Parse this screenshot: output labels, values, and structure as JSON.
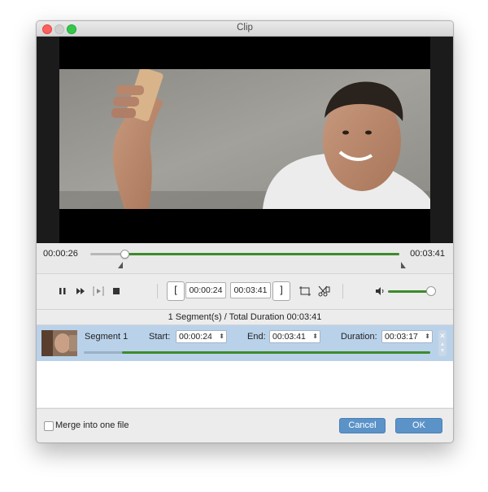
{
  "window": {
    "title": "Clip"
  },
  "timeline": {
    "current_time": "00:00:26",
    "total_time": "00:03:41",
    "playhead_fraction": 0.11
  },
  "controls": {
    "icons": [
      "pause-icon",
      "fast-forward-icon",
      "play-segment-icon",
      "stop-icon",
      "crop-icon",
      "cut-icon",
      "volume-icon"
    ],
    "set_start_label": "[",
    "set_end_label": "]",
    "start_time": "00:00:24",
    "end_time": "00:03:41",
    "volume_fraction": 0.95
  },
  "summary": "1 Segment(s) / Total Duration 00:03:41",
  "segments": [
    {
      "name": "Segment 1",
      "start_label": "Start:",
      "start": "00:00:24",
      "end_label": "End:",
      "end": "00:03:41",
      "duration_label": "Duration:",
      "duration": "00:03:17",
      "progress_start_fraction": 0.11
    }
  ],
  "footer": {
    "merge_label": "Merge into one file",
    "merge_checked": false,
    "cancel_label": "Cancel",
    "ok_label": "OK"
  },
  "colors": {
    "accent_green": "#3d8b2b",
    "button_blue": "#5b93c9",
    "selected_row": "#b9d2ea"
  }
}
